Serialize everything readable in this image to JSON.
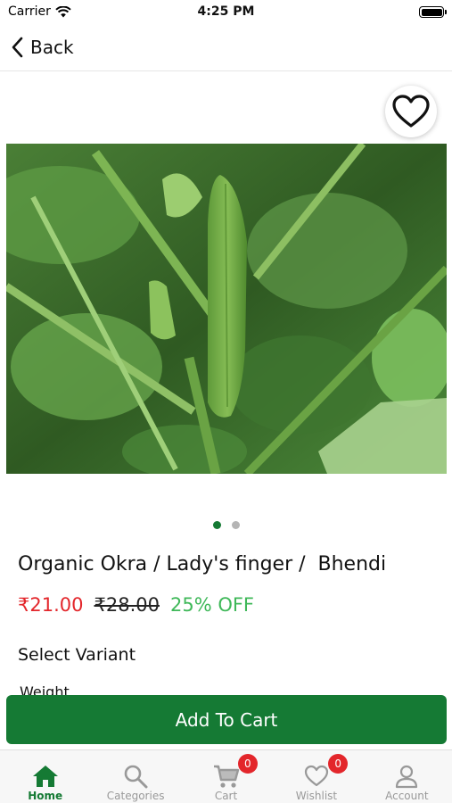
{
  "status_bar": {
    "carrier": "Carrier",
    "time": "4:25 PM"
  },
  "nav": {
    "back_label": "Back"
  },
  "product": {
    "title": "Organic Okra / Lady's finger /  Bhendi",
    "price": "₹21.00",
    "original_price": "₹28.00",
    "discount": "25% OFF",
    "image_icon": "okra-photo",
    "image_page": 1,
    "image_pages": 2
  },
  "variant": {
    "heading": "Select Variant",
    "weight_label": "Weight"
  },
  "actions": {
    "add_to_cart": "Add To Cart"
  },
  "tabs": [
    {
      "label": "Home",
      "icon": "home-icon",
      "active": true
    },
    {
      "label": "Categories",
      "icon": "search-icon"
    },
    {
      "label": "Cart",
      "icon": "cart-icon",
      "badge": "0"
    },
    {
      "label": "Wishlist",
      "icon": "heart-icon",
      "badge": "0"
    },
    {
      "label": "Account",
      "icon": "user-icon"
    }
  ],
  "colors": {
    "primary": "#157a34",
    "price": "#e3262b",
    "discount": "#3fb859",
    "badge": "#e3262b"
  }
}
